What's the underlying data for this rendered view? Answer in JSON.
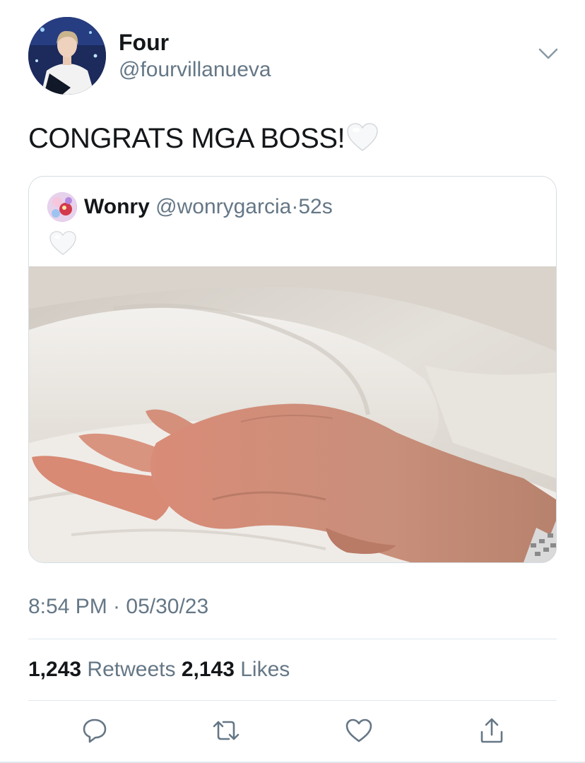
{
  "author": {
    "display_name": "Four",
    "handle": "@fourvillanueva"
  },
  "tweet": {
    "text": "CONGRATS MGA BOSS!",
    "emoji_icon": "white-heart-icon"
  },
  "quoted": {
    "display_name": "Wonry",
    "handle": "@wonrygarcia",
    "separator": "·",
    "age": "52s",
    "emoji_icon": "white-heart-icon",
    "media": "photo"
  },
  "meta": {
    "timestamp": "8:54 PM · 05/30/23"
  },
  "stats": {
    "retweets_count": "1,243",
    "retweets_label": "Retweets",
    "likes_count": "2,143",
    "likes_label": "Likes"
  },
  "actions": [
    {
      "name": "reply",
      "icon": "speech-bubble-icon"
    },
    {
      "name": "retweet",
      "icon": "retweet-arrows-icon"
    },
    {
      "name": "like",
      "icon": "heart-outline-icon"
    },
    {
      "name": "share",
      "icon": "share-upload-icon"
    }
  ],
  "colors": {
    "text_primary": "#14171a",
    "text_secondary": "#657786",
    "divider": "#e1e8ed",
    "icon": "#657786"
  }
}
